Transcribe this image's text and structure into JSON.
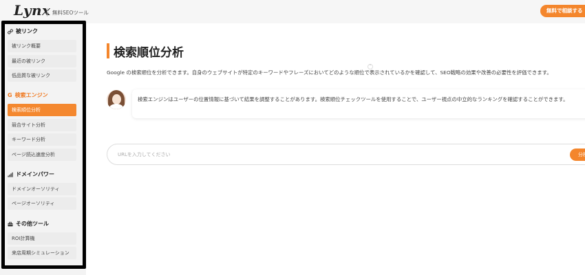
{
  "header": {
    "logo": "Lynx",
    "tagline": "無料SEOツール",
    "cta_label": "無料で相談する"
  },
  "sidebar": {
    "sections": [
      {
        "title": "被リンク",
        "icon": "link-icon",
        "items": [
          "被リンク概要",
          "最近の被リンク",
          "低品質な被リンク"
        ]
      },
      {
        "title": "検索エンジン",
        "icon": "google-g-icon",
        "items": [
          "検索順位分析",
          "競合サイト分析",
          "キーワード分析",
          "ページ読込速度分析"
        ]
      },
      {
        "title": "ドメインパワー",
        "icon": "signal-bars-icon",
        "items": [
          "ドメインオーソリティ",
          "ページオーソリティ"
        ]
      },
      {
        "title": "その他ツール",
        "icon": "toolbox-icon",
        "items": [
          "ROI計算機",
          "来店周期シミュレーション"
        ]
      }
    ],
    "active_item": "検索順位分析"
  },
  "main": {
    "title": "検索順位分析",
    "description": "Google の検索順位を分析できます。自身のウェブサイトが特定のキーワードやフレーズにおいてどのような順位で表示されているかを確認して、SEO戦略の効果や改善の必要性を評価できます。",
    "tip_text": "検索エンジンはユーザーの位置情報に基づいて結果を調整することがあります。検索順位チェックツールを使用することで、ユーザー視点の中立的なランキングを確認することができます。",
    "search": {
      "placeholder": "URLを入力してください",
      "value": "",
      "button_label": "分析"
    }
  },
  "colors": {
    "accent": "#f4862c",
    "sidebar_bg": "#f3f3f3",
    "header_bg": "#f6f6f6"
  }
}
